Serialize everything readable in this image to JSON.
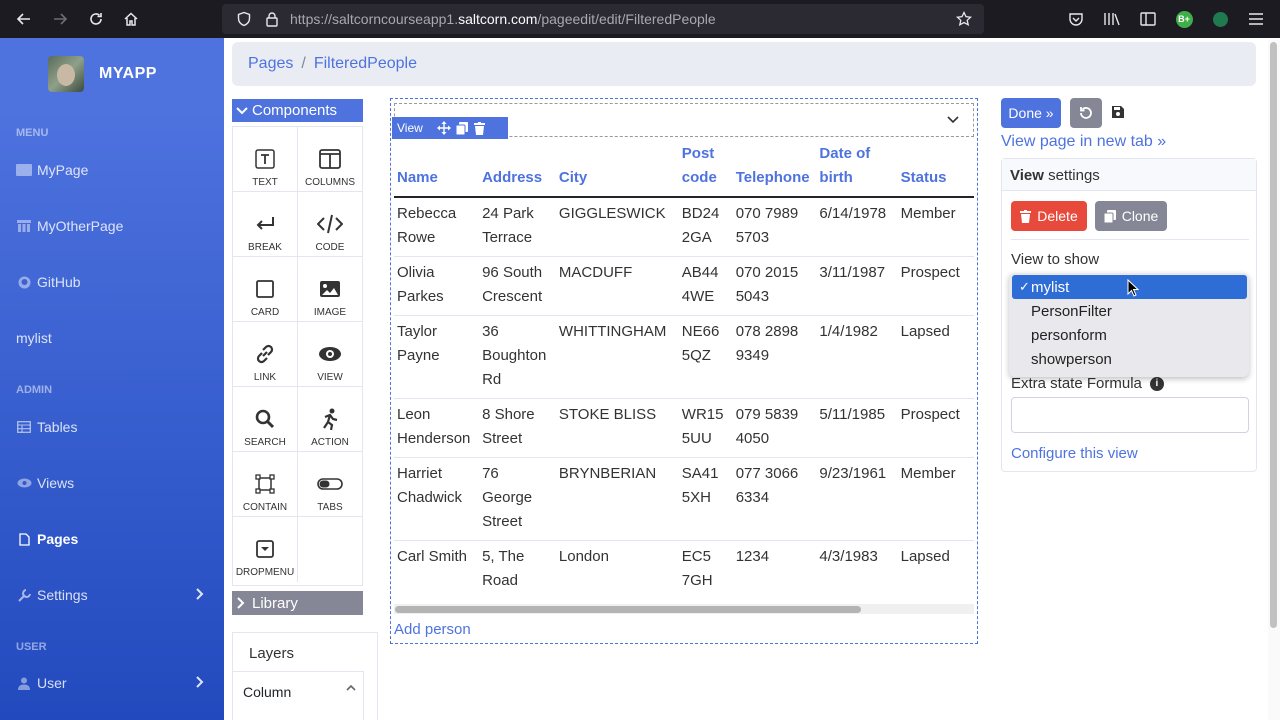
{
  "browser": {
    "url_host_prefix": "https://saltcorncourseapp1.",
    "url_host_main": "saltcorn.com",
    "url_path": "/pageedit/edit/FilteredPeople",
    "ext_badge": "B+"
  },
  "sidebar": {
    "app_name": "MYAPP",
    "menu_label": "MENU",
    "menu_items": [
      "MyPage",
      "MyOtherPage",
      "GitHub",
      "mylist"
    ],
    "admin_label": "ADMIN",
    "admin_items": [
      "Tables",
      "Views",
      "Pages",
      "Settings"
    ],
    "user_label": "USER",
    "user_item": "User"
  },
  "breadcrumb": {
    "root": "Pages",
    "sep": "/",
    "current": "FilteredPeople"
  },
  "components": {
    "title": "Components",
    "items": [
      "TEXT",
      "COLUMNS",
      "BREAK",
      "CODE",
      "CARD",
      "IMAGE",
      "LINK",
      "VIEW",
      "SEARCH",
      "ACTION",
      "CONTAIN",
      "TABS",
      "DROPMENU"
    ],
    "library": "Library"
  },
  "layers": {
    "title": "Layers",
    "item": "Column"
  },
  "view_tag": "View",
  "table": {
    "headers": [
      [
        "Name"
      ],
      [
        "Address"
      ],
      [
        "City"
      ],
      [
        "Post",
        "code"
      ],
      [
        "Telephone"
      ],
      [
        "Date of",
        "birth"
      ],
      [
        "Status"
      ]
    ],
    "rows": [
      [
        [
          "Rebecca",
          "Rowe"
        ],
        [
          "24 Park",
          "Terrace"
        ],
        [
          "GIGGLESWICK"
        ],
        [
          "BD24",
          "2GA"
        ],
        [
          "070 7989",
          "5703"
        ],
        [
          "6/14/1978"
        ],
        [
          "Member"
        ]
      ],
      [
        [
          "Olivia",
          "Parkes"
        ],
        [
          "96 South",
          "Crescent"
        ],
        [
          "MACDUFF"
        ],
        [
          "AB44",
          "4WE"
        ],
        [
          "070 2015",
          "5043"
        ],
        [
          "3/11/1987"
        ],
        [
          "Prospect"
        ]
      ],
      [
        [
          "Taylor",
          "Payne"
        ],
        [
          "36",
          "Boughton",
          "Rd"
        ],
        [
          "WHITTINGHAM"
        ],
        [
          "NE66",
          "5QZ"
        ],
        [
          "078 2898",
          "9349"
        ],
        [
          "1/4/1982"
        ],
        [
          "Lapsed"
        ]
      ],
      [
        [
          "Leon",
          "Henderson"
        ],
        [
          "8 Shore",
          "Street"
        ],
        [
          "STOKE BLISS"
        ],
        [
          "WR15",
          "5UU"
        ],
        [
          "079 5839",
          "4050"
        ],
        [
          "5/11/1985"
        ],
        [
          "Prospect"
        ]
      ],
      [
        [
          "Harriet",
          "Chadwick"
        ],
        [
          "76",
          "George",
          "Street"
        ],
        [
          "BRYNBERIAN"
        ],
        [
          "SA41",
          "5XH"
        ],
        [
          "077 3066",
          "6334"
        ],
        [
          "9/23/1961"
        ],
        [
          "Member"
        ]
      ],
      [
        [
          "Carl Smith"
        ],
        [
          "5, The",
          "Road"
        ],
        [
          "London"
        ],
        [
          "EC5",
          "7GH"
        ],
        [
          "1234"
        ],
        [
          "4/3/1983"
        ],
        [
          "Lapsed"
        ]
      ]
    ],
    "add_link": "Add person"
  },
  "right": {
    "done_label": "Done »",
    "view_new_tab": "View page in new tab »",
    "settings_bold": "View",
    "settings_rest": " settings",
    "delete_label": "Delete",
    "clone_label": "Clone",
    "view_to_show_label": "View to show",
    "view_options": [
      "mylist",
      "PersonFilter",
      "personform",
      "showperson"
    ],
    "selected_check": "✓",
    "extra_state_label": "Extra state Formula",
    "configure_link": "Configure this view"
  },
  "colors": {
    "primary": "#4e73df",
    "danger": "#e74a3b",
    "secondary": "#858796"
  }
}
